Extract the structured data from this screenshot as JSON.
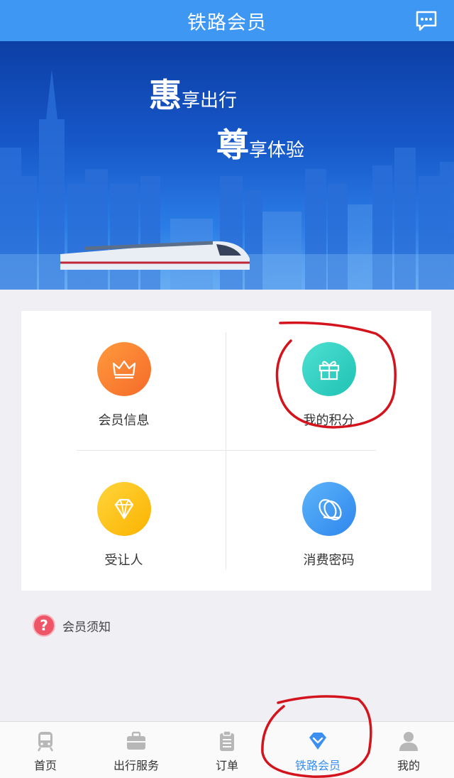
{
  "header": {
    "title": "铁路会员",
    "message_icon": "message-icon"
  },
  "banner": {
    "slogan1_big": "惠",
    "slogan1_small": "享出行",
    "slogan2_big": "尊",
    "slogan2_small": "享体验"
  },
  "menu": {
    "items": [
      {
        "label": "会员信息",
        "icon": "crown-icon",
        "color": "#f57a30"
      },
      {
        "label": "我的积分",
        "icon": "gift-icon",
        "color": "#2ccbbd"
      },
      {
        "label": "受让人",
        "icon": "diamond-icon",
        "color": "#fcc21a"
      },
      {
        "label": "消费密码",
        "icon": "coins-icon",
        "color": "#3f95f1"
      }
    ]
  },
  "notice": {
    "icon_text": "?",
    "label": "会员须知"
  },
  "tabbar": {
    "items": [
      {
        "label": "首页",
        "icon": "train-icon"
      },
      {
        "label": "出行服务",
        "icon": "briefcase-icon"
      },
      {
        "label": "订单",
        "icon": "clipboard-icon"
      },
      {
        "label": "铁路会员",
        "icon": "diamond-icon",
        "active": true
      },
      {
        "label": "我的",
        "icon": "user-icon"
      }
    ]
  },
  "colors": {
    "accent": "#3d97f3",
    "annotation": "#d4141c"
  }
}
